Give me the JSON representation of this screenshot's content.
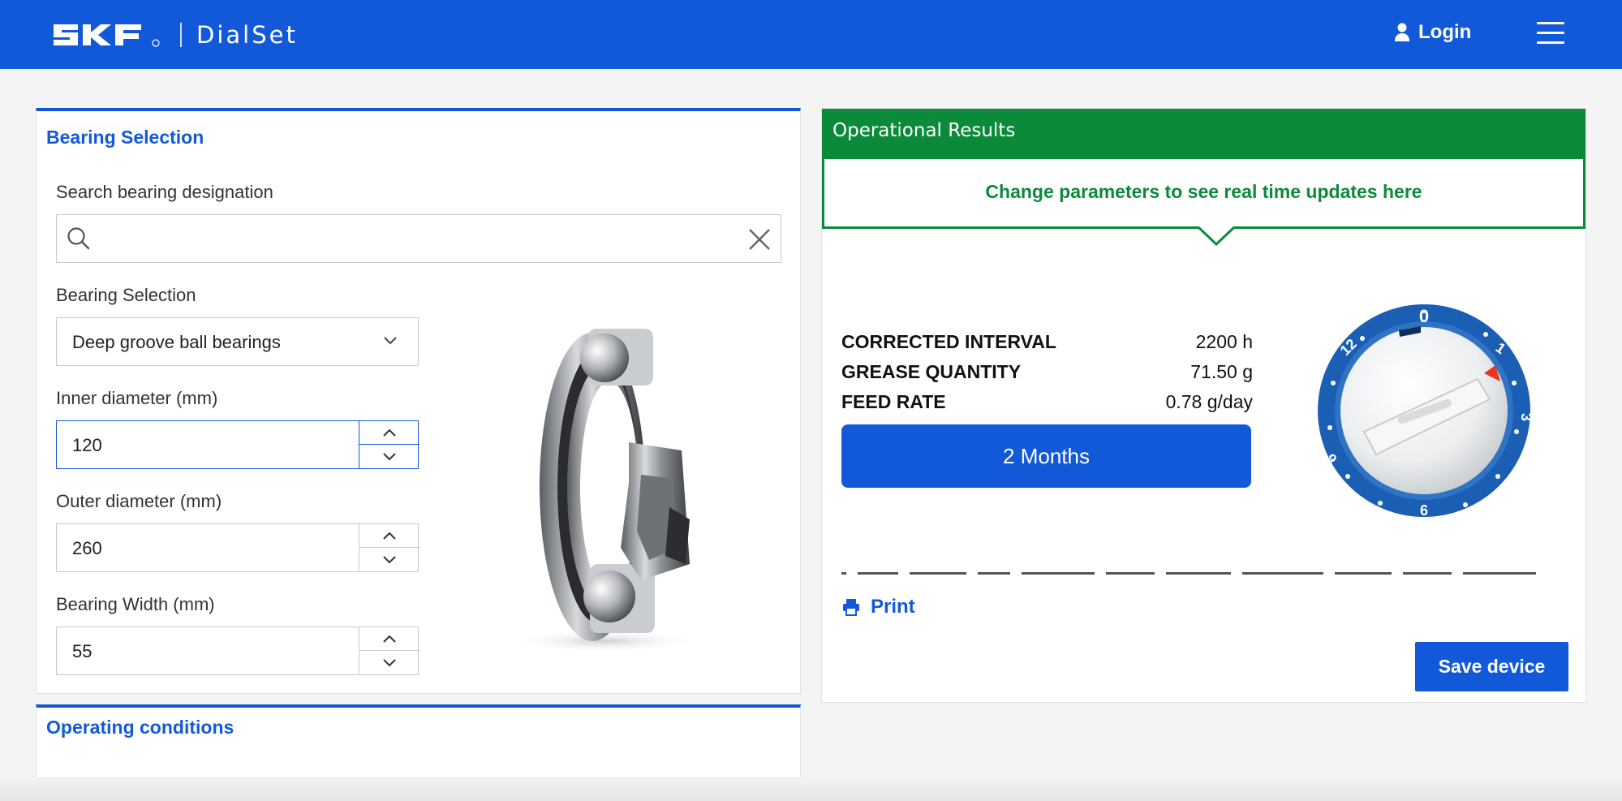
{
  "header": {
    "brand": "SKF",
    "app_name": "DialSet",
    "login_label": "Login"
  },
  "bearing_selection": {
    "title": "Bearing Selection",
    "search": {
      "label": "Search bearing designation",
      "value": "",
      "placeholder": ""
    },
    "type": {
      "label": "Bearing Selection",
      "value": "Deep groove ball bearings"
    },
    "inner_diameter": {
      "label": "Inner diameter (mm)",
      "value": "120"
    },
    "outer_diameter": {
      "label": "Outer diameter (mm)",
      "value": "260"
    },
    "width": {
      "label": "Bearing Width (mm)",
      "value": "55"
    }
  },
  "operating_conditions": {
    "title": "Operating conditions"
  },
  "results": {
    "title": "Operational Results",
    "banner": "Change parameters to see real time updates here",
    "rows": [
      {
        "key": "CORRECTED INTERVAL",
        "value": "2200 h"
      },
      {
        "key": "GREASE QUANTITY",
        "value": "71.50 g"
      },
      {
        "key": "FEED RATE",
        "value": "0.78 g/day"
      }
    ],
    "setting_label": "2 Months",
    "dial_labels": [
      "0",
      "1",
      "3",
      "6",
      "9",
      "12"
    ],
    "print_label": "Print",
    "save_label": "Save device"
  },
  "colors": {
    "brand_blue": "#1259d9",
    "result_green": "#0b8a3a",
    "dial_pointer": "#e8361f"
  }
}
